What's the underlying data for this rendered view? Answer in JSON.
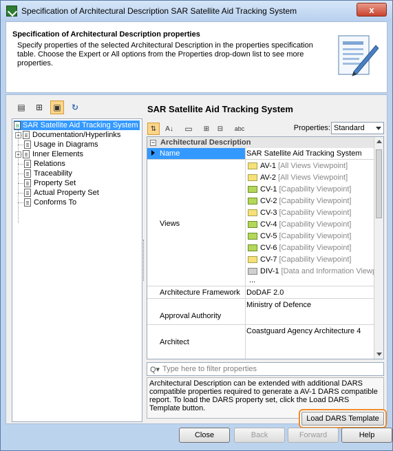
{
  "window": {
    "title": "Specification of Architectural Description SAR Satellite Aid Tracking System",
    "close_label": "x"
  },
  "header": {
    "heading": "Specification of Architectural Description properties",
    "description": "Specify properties of the selected Architectural Description in the properties specification table. Choose the Expert or All options from the Properties drop-down list to see more properties."
  },
  "tree": {
    "root": "SAR Satellite Aid Tracking System",
    "items": [
      "Documentation/Hyperlinks",
      "Usage in Diagrams",
      "Inner Elements",
      "Relations",
      "Traceability",
      "Property Set",
      "Actual Property Set",
      "Conforms To"
    ]
  },
  "panel": {
    "title": "SAR Satellite Aid Tracking System",
    "properties_label": "Properties:",
    "properties_value": "Standard"
  },
  "grid": {
    "group": "Architectural Description",
    "name_label": "Name",
    "name_value": "SAR Satellite Aid Tracking System",
    "views_label": "Views",
    "views": [
      {
        "id": "AV-1",
        "desc": "[All Views Viewpoint]",
        "color": "y"
      },
      {
        "id": "AV-2",
        "desc": "[All Views Viewpoint]",
        "color": "y"
      },
      {
        "id": "CV-1",
        "desc": "[Capability Viewpoint]",
        "color": "g"
      },
      {
        "id": "CV-2",
        "desc": "[Capability Viewpoint]",
        "color": "g"
      },
      {
        "id": "CV-3",
        "desc": "[Capability Viewpoint]",
        "color": "y"
      },
      {
        "id": "CV-4",
        "desc": "[Capability Viewpoint]",
        "color": "g"
      },
      {
        "id": "CV-5",
        "desc": "[Capability Viewpoint]",
        "color": "g"
      },
      {
        "id": "CV-6",
        "desc": "[Capability Viewpoint]",
        "color": "g"
      },
      {
        "id": "CV-7",
        "desc": "[Capability Viewpoint]",
        "color": "y"
      },
      {
        "id": "DIV-1",
        "desc": "[Data and Information Viewpoi",
        "color": "gray"
      }
    ],
    "ellipsis": "...",
    "framework_label": "Architecture Framework",
    "framework_value": "DoDAF 2.0",
    "approval_label": "Approval Authority",
    "approval_value": "Ministry of Defence",
    "architect_label": "Architect",
    "architect_value": "Coastguard Agency Architecture 4"
  },
  "filter": {
    "placeholder": "Type here to filter properties"
  },
  "info": {
    "text": "Architectural Description can be extended with additional DARS compatible properties required to generate a AV-1 DARS compatible report. To load the DARS property set, click the Load DARS Template button."
  },
  "buttons": {
    "load_dars": "Load DARS Template",
    "close": "Close",
    "back": "Back",
    "forward": "Forward",
    "help": "Help"
  }
}
